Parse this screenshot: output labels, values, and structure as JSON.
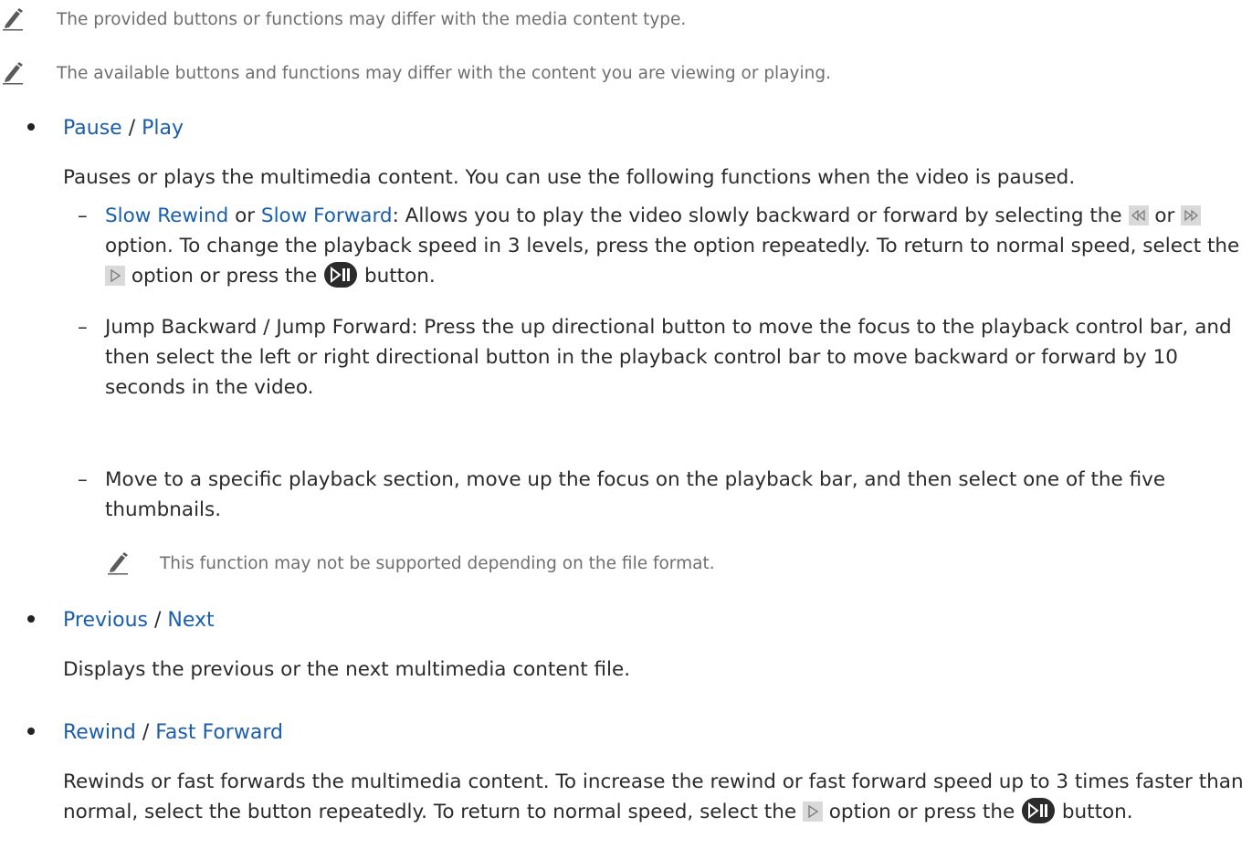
{
  "notes": [
    "The provided buttons or functions may differ with the media content type.",
    "The available buttons and functions may differ with the content you are viewing or playing."
  ],
  "items": [
    {
      "title_a": "Pause",
      "separator": "/",
      "title_b": "Play",
      "description": "Pauses or plays the multimedia content. You can use the following functions when the video is paused."
    },
    {
      "title_a": "Previous",
      "separator": "/",
      "title_b": "Next",
      "description": "Displays the previous or the next multimedia content file."
    },
    {
      "title_a": "Rewind",
      "separator": "/",
      "title_b": "Fast Forward",
      "description_part1": "Rewinds or fast forwards the multimedia content. To increase the rewind or fast forward speed up to 3 times faster than normal, select the button repeatedly. To return to normal speed, select the",
      "description_part2": "option or press the",
      "description_part3": "button."
    }
  ],
  "sub_items": {
    "slow": {
      "link_a": "Slow Rewind",
      "or": "or",
      "link_b": "Slow Forward",
      "text1": ": Allows you to play the video slowly backward or forward by selecting the",
      "text2": "or",
      "text3": "option. To change the playback speed in 3 levels, press the option repeatedly. To return to normal speed, select the",
      "text4": "option or press the",
      "text5": "button."
    },
    "jump": "Jump Backward / Jump Forward: Press the up directional button to move the focus to the playback control bar, and then select the left or right directional button in the playback control bar to move backward or forward by 10 seconds in the video.",
    "move": "Move to a specific playback section, move up the focus on the playback bar, and then select one of the five thumbnails.",
    "sub_note": "This function may not be supported depending on the file format."
  },
  "icons": {
    "note": "pencil-icon",
    "slow_rewind": "slow-rewind-icon",
    "slow_forward": "slow-forward-icon",
    "play": "play-icon",
    "play_pause_button": "play-pause-button-icon"
  }
}
